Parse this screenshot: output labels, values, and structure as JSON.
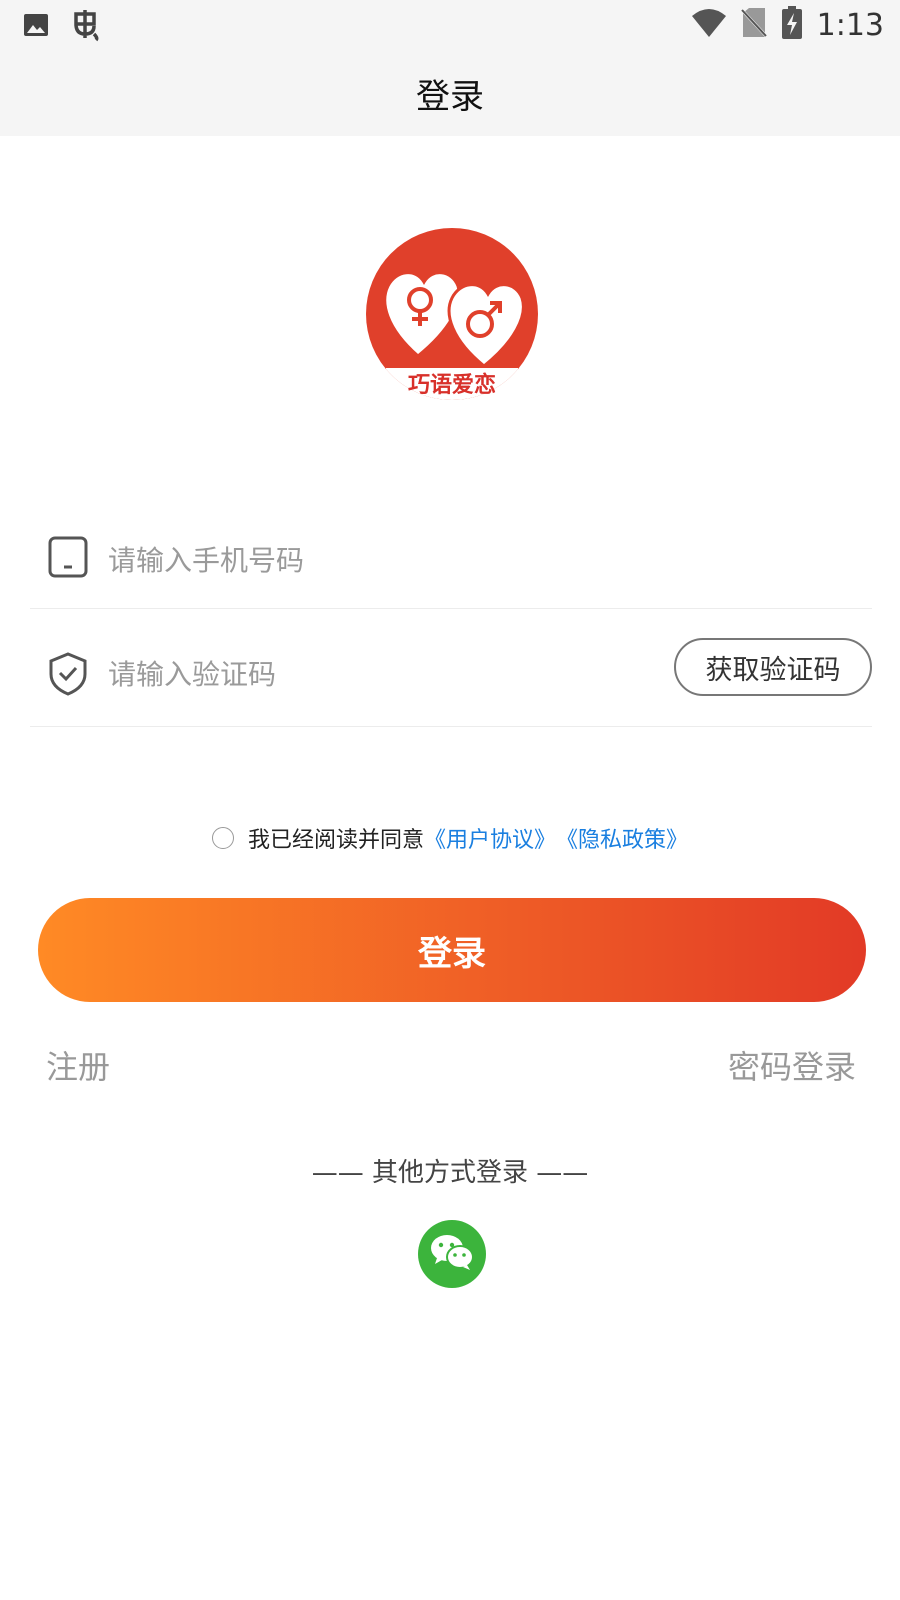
{
  "status_bar": {
    "time": "1:13",
    "icons": [
      "image-icon",
      "bug-icon",
      "wifi-icon",
      "no-sim-icon",
      "battery-charging-icon"
    ]
  },
  "header": {
    "title": "登录"
  },
  "logo": {
    "text": "巧语爱恋",
    "colors": {
      "circle": "#e0402b",
      "heart": "#ffffff"
    }
  },
  "phone_field": {
    "placeholder": "请输入手机号码",
    "icon": "phone-icon"
  },
  "code_field": {
    "placeholder": "请输入验证码",
    "icon": "shield-check-icon"
  },
  "get_code_button": {
    "label": "获取验证码"
  },
  "agreement": {
    "text": "我已经阅读并同意",
    "user_agreement": "《用户协议》",
    "privacy_policy": "《隐私政策》",
    "checked": false
  },
  "login_button": {
    "label": "登录",
    "gradient": [
      "#ff8a25",
      "#e23a26"
    ]
  },
  "register_link": {
    "label": "注册"
  },
  "password_login_link": {
    "label": "密码登录"
  },
  "other_login": {
    "label": "—— 其他方式登录 ——"
  },
  "wechat_button": {
    "icon": "wechat-icon",
    "color": "#3cb43c"
  },
  "colors": {
    "link": "#1a7fe0",
    "placeholder": "#9a9a9a",
    "muted": "#999999"
  }
}
